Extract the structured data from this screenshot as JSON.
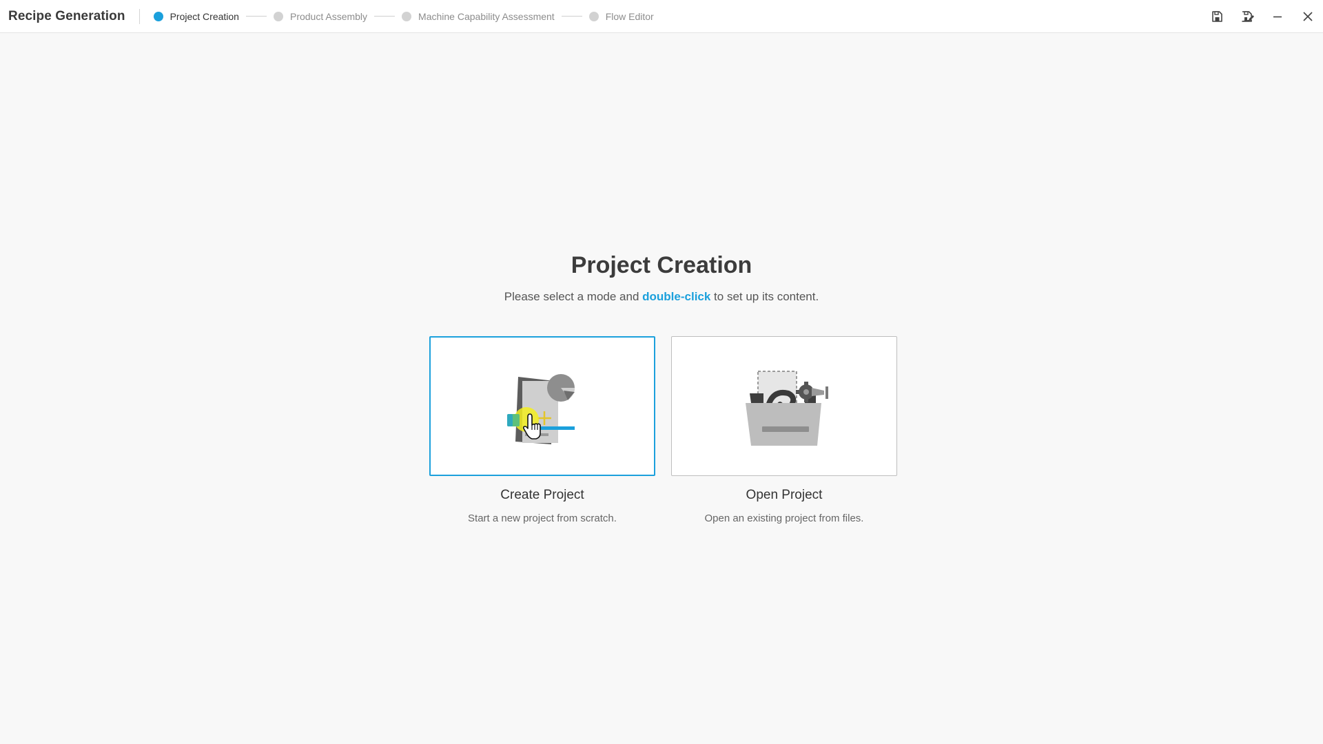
{
  "app": {
    "title": "Recipe Generation"
  },
  "steps": [
    {
      "label": "Project Creation",
      "active": true
    },
    {
      "label": "Product Assembly",
      "active": false
    },
    {
      "label": "Machine Capability Assessment",
      "active": false
    },
    {
      "label": "Flow Editor",
      "active": false
    }
  ],
  "window_controls": {
    "icons": [
      "save-icon",
      "save-as-icon",
      "minimize-icon",
      "close-icon"
    ]
  },
  "main": {
    "title": "Project Creation",
    "subtitle_before": "Please select a mode and ",
    "subtitle_accent": "double-click",
    "subtitle_after": " to set up its content.",
    "cards": [
      {
        "title": "Create Project",
        "description": "Start a new project from scratch.",
        "selected": true,
        "icon": "create-project-illustration"
      },
      {
        "title": "Open Project",
        "description": "Open an existing project from files.",
        "selected": false,
        "icon": "open-project-illustration"
      }
    ]
  },
  "colors": {
    "accent": "#1ba0dc",
    "background": "#f8f8f8"
  }
}
